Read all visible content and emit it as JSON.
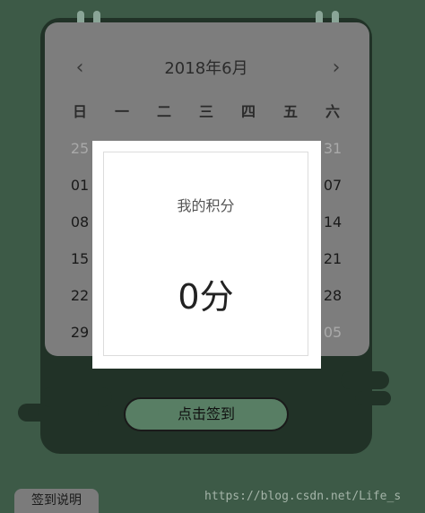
{
  "calendar": {
    "title": "2018年6月",
    "prev": "‹",
    "next": "›",
    "weekdays": [
      "日",
      "一",
      "二",
      "三",
      "四",
      "五",
      "六"
    ],
    "visible_dates": {
      "row1_left": "25",
      "row1_right": "31",
      "row2_left": "01",
      "row2_right": "07",
      "row3_left": "08",
      "row3_right": "14",
      "row4_left": "15",
      "row4_right": "21",
      "row5_left": "22",
      "row5_right": "28",
      "row6_left": "29",
      "row6_right": "05"
    }
  },
  "popup": {
    "title": "我的积分",
    "score": "0分"
  },
  "sign_button": "点击签到",
  "explain_button": "签到说明",
  "watermark": "https://blog.csdn.net/Life_s",
  "colors": {
    "background": "#3d5a47",
    "board": "#213227",
    "card": "#7d7d7d",
    "button": "#587e64"
  }
}
